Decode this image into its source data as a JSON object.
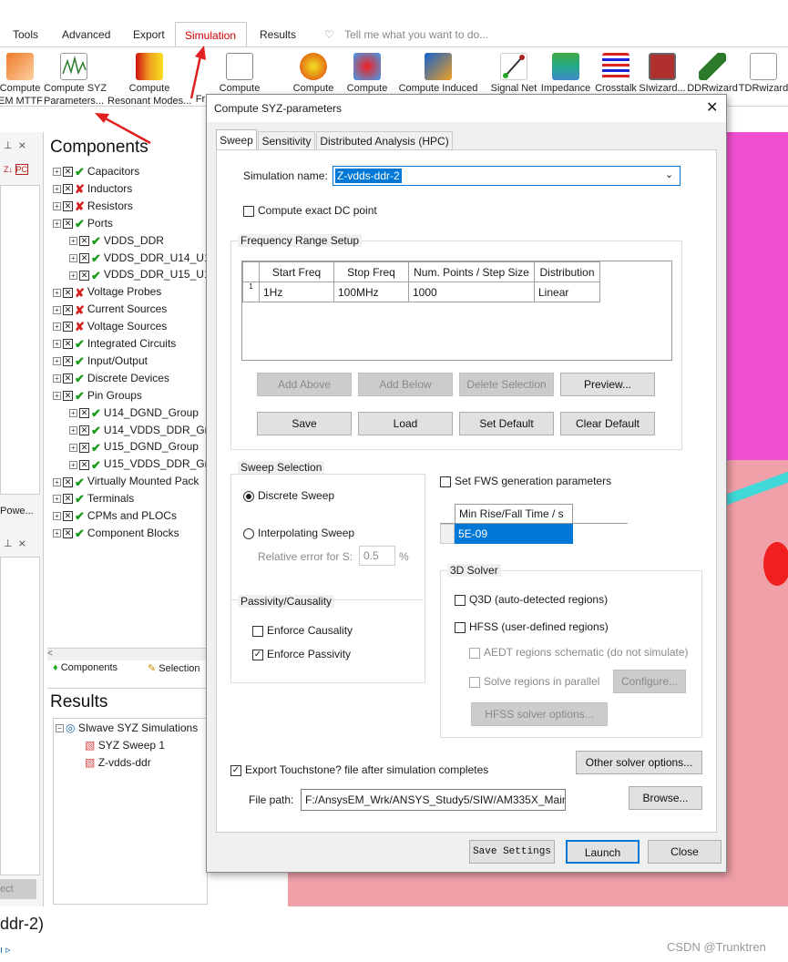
{
  "ribbon": {
    "tabs": [
      "Tools",
      "Advanced",
      "Export",
      "Simulation",
      "Results"
    ],
    "tell_me": "Tell me what you want to do...",
    "buttons_left": [
      {
        "label1": "Compute",
        "label2": "EM MTTF"
      },
      {
        "label1": "Compute SYZ",
        "label2": "Parameters..."
      },
      {
        "label1": "Compute",
        "label2": "Resonant Modes..."
      },
      {
        "label1": "",
        "label2": "Fr"
      }
    ],
    "buttons_right": [
      "Compute",
      "Compute",
      "Compute",
      "Compute Induced",
      "Signal Net",
      "Impedance",
      "Crosstalk",
      "SIwizard...",
      "DDRwizard",
      "TDRwizard"
    ]
  },
  "components_panel": {
    "title": "Components",
    "items": [
      {
        "label": "Capacitors",
        "state": "ok",
        "level": 0
      },
      {
        "label": "Inductors",
        "state": "bad",
        "level": 0
      },
      {
        "label": "Resistors",
        "state": "bad",
        "level": 0
      },
      {
        "label": "Ports",
        "state": "ok",
        "level": 0
      },
      {
        "label": "VDDS_DDR",
        "state": "ok",
        "level": 1
      },
      {
        "label": "VDDS_DDR_U14_U1",
        "state": "ok",
        "level": 1
      },
      {
        "label": "VDDS_DDR_U15_U1",
        "state": "ok",
        "level": 1
      },
      {
        "label": "Voltage Probes",
        "state": "bad",
        "level": 0
      },
      {
        "label": "Current Sources",
        "state": "bad",
        "level": 0
      },
      {
        "label": "Voltage Sources",
        "state": "bad",
        "level": 0
      },
      {
        "label": "Integrated Circuits",
        "state": "ok",
        "level": 0
      },
      {
        "label": "Input/Output",
        "state": "ok",
        "level": 0
      },
      {
        "label": "Discrete Devices",
        "state": "ok",
        "level": 0
      },
      {
        "label": "Pin Groups",
        "state": "ok",
        "level": 0
      },
      {
        "label": "U14_DGND_Group",
        "state": "ok",
        "level": 1
      },
      {
        "label": "U14_VDDS_DDR_Gr",
        "state": "ok",
        "level": 1
      },
      {
        "label": "U15_DGND_Group",
        "state": "ok",
        "level": 1
      },
      {
        "label": "U15_VDDS_DDR_Gr",
        "state": "ok",
        "level": 1
      },
      {
        "label": "Virtually Mounted Pack",
        "state": "ok",
        "level": 0
      },
      {
        "label": "Terminals",
        "state": "ok",
        "level": 0
      },
      {
        "label": "CPMs and PLOCs",
        "state": "ok",
        "level": 0
      },
      {
        "label": "Component Blocks",
        "state": "ok",
        "level": 0
      }
    ],
    "tab_components": "Components",
    "tab_selection": "Selection",
    "left_sort_label": "PC",
    "left_label_powe": "Powe..."
  },
  "results_panel": {
    "title": "Results",
    "root": "SIwave SYZ Simulations",
    "children": [
      "SYZ Sweep 1",
      "Z-vdds-ddr"
    ]
  },
  "bottom_status": "ddr-2)",
  "left_btn": "ect",
  "watermark": "CSDN @Trunktren",
  "dialog": {
    "title": "Compute SYZ-parameters",
    "tabs": [
      "Sweep",
      "Sensitivity",
      "Distributed Analysis (HPC)"
    ],
    "simulation_name_label": "Simulation name:",
    "simulation_name": "Z-vdds-ddr-2",
    "compute_dc_label": "Compute exact DC point",
    "freq_group": "Frequency Range Setup",
    "freq_headers": [
      "Start Freq",
      "Stop Freq",
      "Num. Points / Step Size",
      "Distribution"
    ],
    "freq_rows": [
      [
        "1",
        "1Hz",
        "100MHz",
        "1000",
        "Linear"
      ]
    ],
    "btn_add_above": "Add Above",
    "btn_add_below": "Add Below",
    "btn_delete": "Delete Selection",
    "btn_preview": "Preview...",
    "btn_save": "Save",
    "btn_load": "Load",
    "btn_set_default": "Set Default",
    "btn_clear_default": "Clear Default",
    "sweep_group": "Sweep Selection",
    "discrete_sweep": "Discrete Sweep",
    "interp_sweep": "Interpolating Sweep",
    "rel_error_label": "Relative error for S:",
    "rel_error_value": "0.5",
    "rel_error_unit": "%",
    "passivity_group": "Passivity/Causality",
    "enforce_causality": "Enforce Causality",
    "enforce_passivity": "Enforce Passivity",
    "fws_label": "Set FWS generation parameters",
    "fws_header": "Min Rise/Fall Time / s",
    "fws_value": "5E-09",
    "solver_group": "3D Solver",
    "q3d_label": "Q3D (auto-detected regions)",
    "hfss_label": "HFSS (user-defined regions)",
    "aedt_label": "AEDT regions schematic (do not simulate)",
    "solve_parallel_label": "Solve regions in parallel",
    "configure_btn": "Configure...",
    "hfss_options_btn": "HFSS solver options...",
    "export_label": "Export Touchstone? file after simulation completes",
    "other_solver_btn": "Other solver options...",
    "file_path_label": "File path:",
    "file_path": "F:/AnsysEM_Wrk/ANSYS_Study5/SIW/AM335X_Mainl",
    "browse_btn": "Browse...",
    "save_settings_btn": "Save Settings",
    "launch_btn": "Launch",
    "close_btn": "Close"
  }
}
